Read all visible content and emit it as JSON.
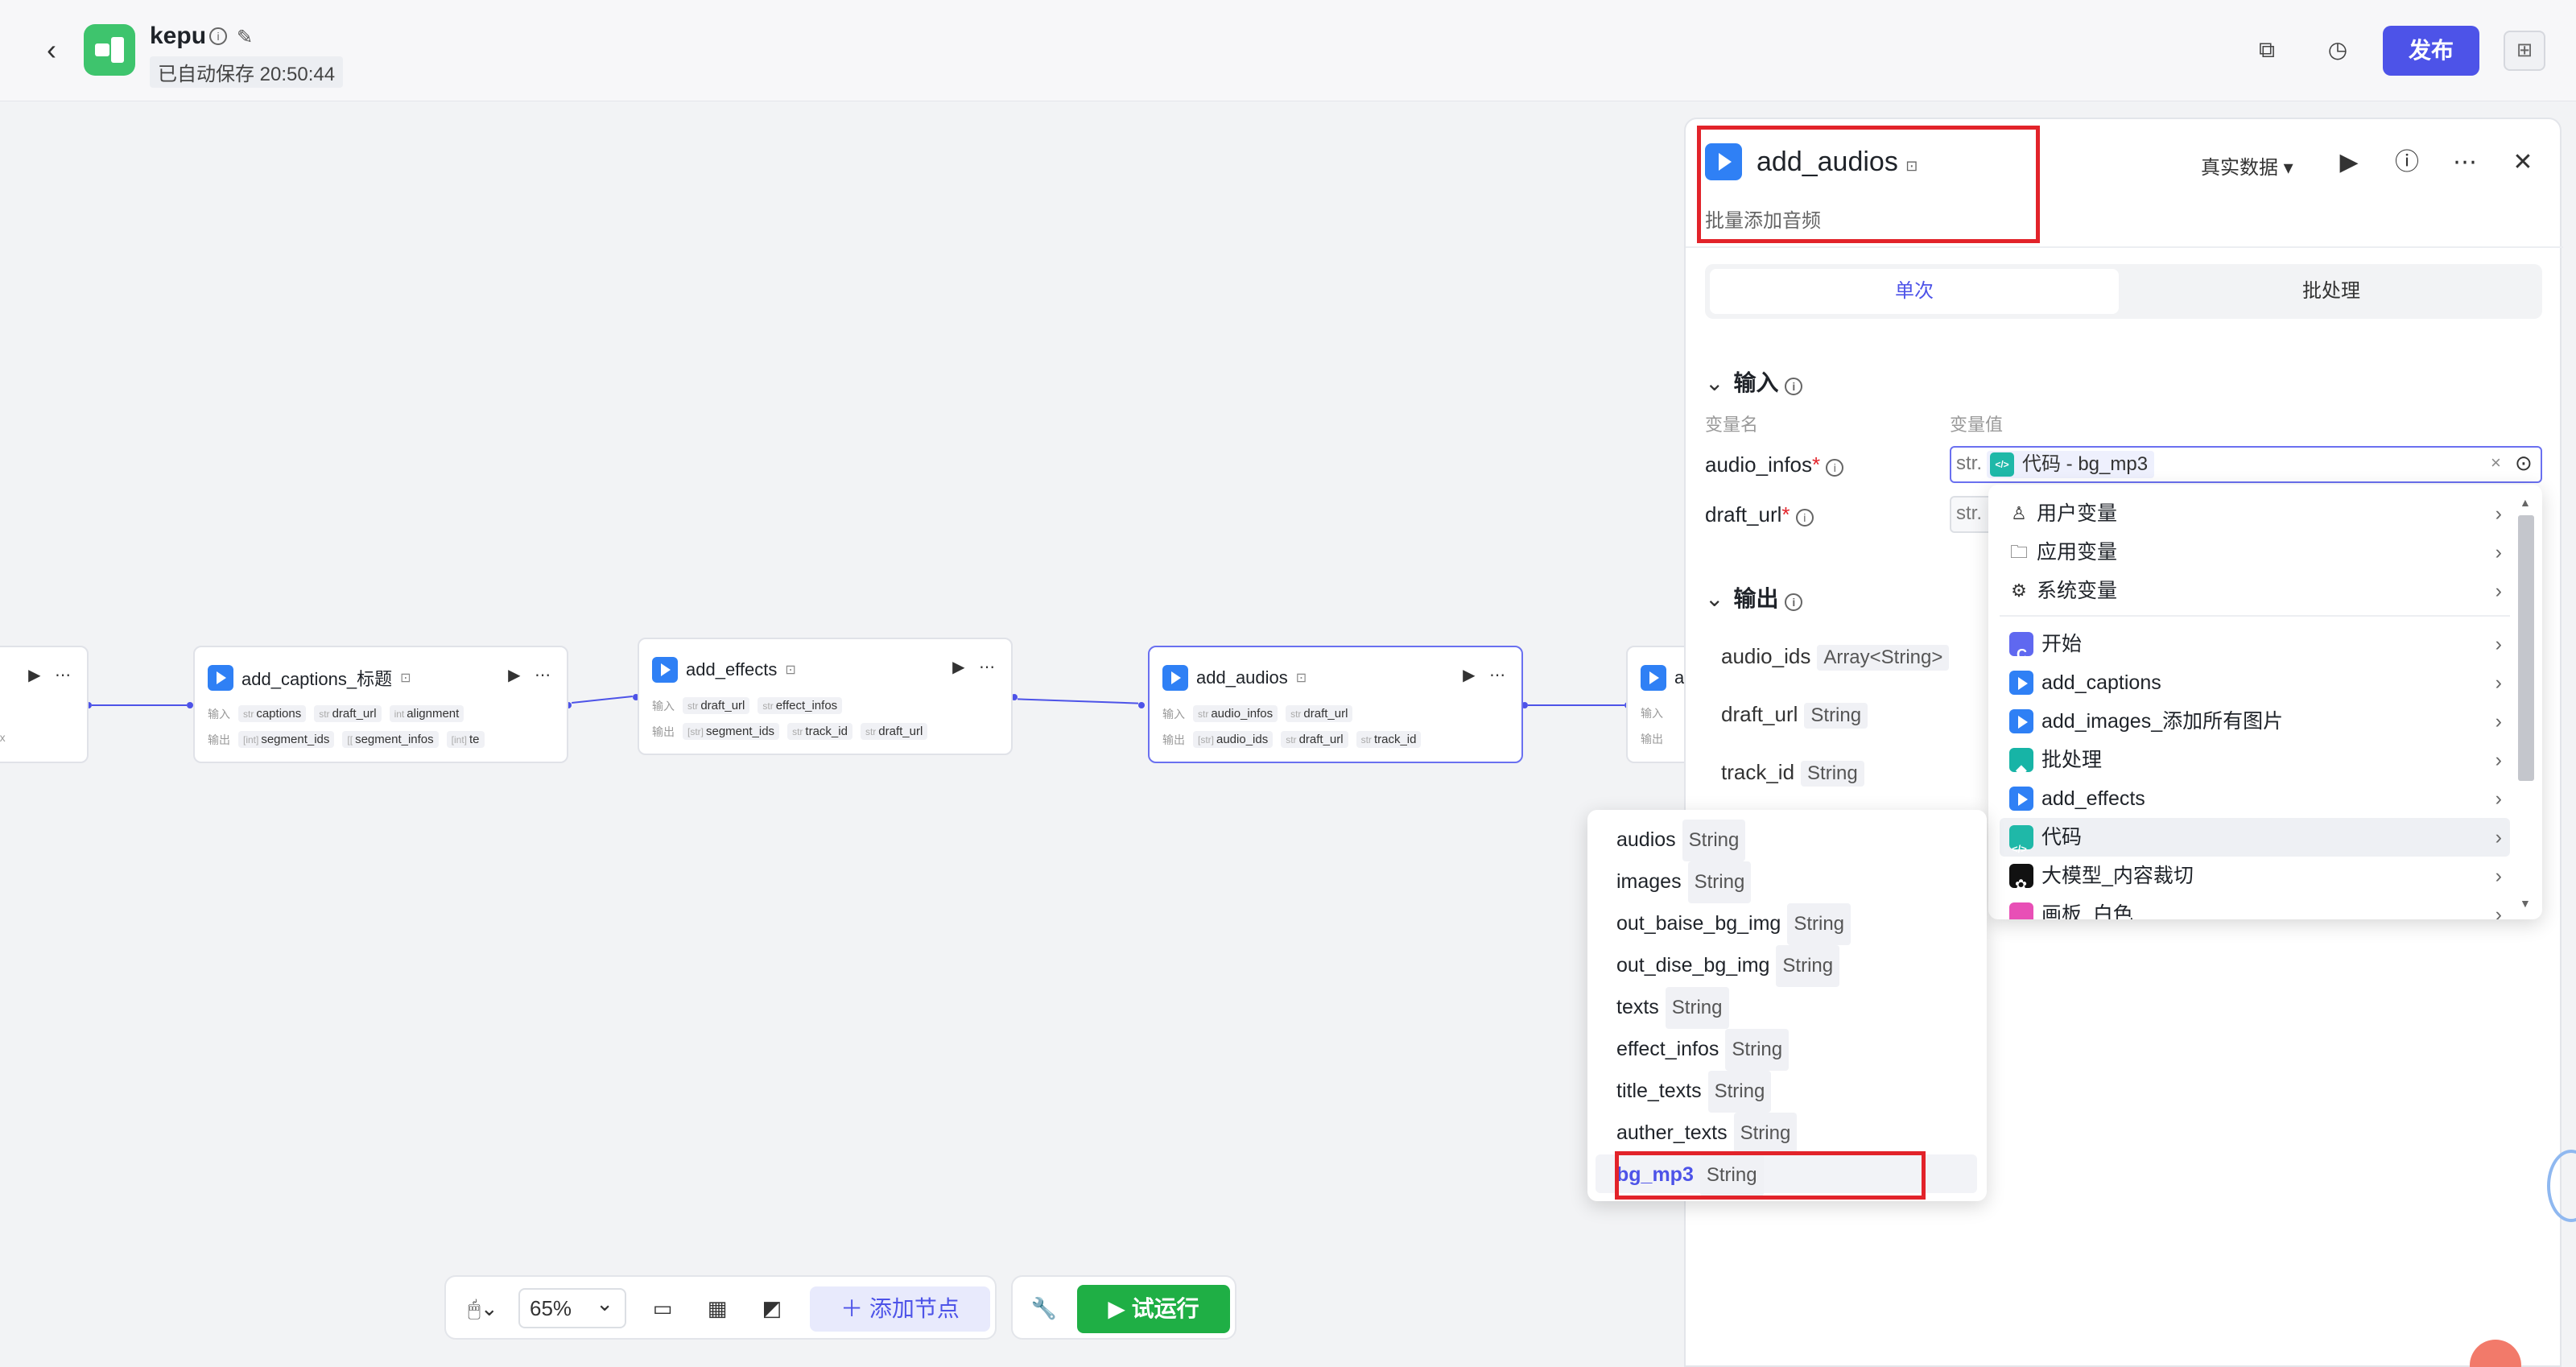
{
  "header": {
    "app_name": "kepu",
    "autosave": "已自动保存 20:50:44",
    "publish_label": "发布"
  },
  "nodes": [
    {
      "id": "left-partial",
      "title": "",
      "in": [
        "nt"
      ],
      "out": [
        "tex"
      ]
    },
    {
      "id": "add_captions",
      "title": "add_captions_标题",
      "in_label": "输入",
      "out_label": "输出",
      "in": [
        {
          "t": "str",
          "n": "captions"
        },
        {
          "t": "str",
          "n": "draft_url"
        },
        {
          "t": "int",
          "n": "alignment"
        }
      ],
      "out": [
        {
          "t": "[int]",
          "n": "segment_ids"
        },
        {
          "t": "[[",
          "n": "segment_infos"
        },
        {
          "t": "[int]",
          "n": "te"
        }
      ]
    },
    {
      "id": "add_effects",
      "title": "add_effects",
      "in_label": "输入",
      "out_label": "输出",
      "in": [
        {
          "t": "str",
          "n": "draft_url"
        },
        {
          "t": "str",
          "n": "effect_infos"
        }
      ],
      "out": [
        {
          "t": "[str]",
          "n": "segment_ids"
        },
        {
          "t": "str",
          "n": "track_id"
        },
        {
          "t": "str",
          "n": "draft_url"
        }
      ]
    },
    {
      "id": "add_audios",
      "title": "add_audios",
      "in_label": "输入",
      "out_label": "输出",
      "in": [
        {
          "t": "str",
          "n": "audio_infos"
        },
        {
          "t": "str",
          "n": "draft_url"
        }
      ],
      "out": [
        {
          "t": "[str]",
          "n": "audio_ids"
        },
        {
          "t": "str",
          "n": "draft_url"
        },
        {
          "t": "str",
          "n": "track_id"
        }
      ]
    },
    {
      "id": "right-partial",
      "title": "a",
      "in_label": "输入",
      "out_label": "输出"
    }
  ],
  "toolbar": {
    "zoom": "65%",
    "add_node": "添加节点",
    "test_run": "试运行"
  },
  "panel": {
    "title": "add_audios",
    "subtitle": "批量添加音频",
    "mode": "真实数据",
    "tabs": [
      "单次",
      "批处理"
    ],
    "input_section": "输入",
    "col_name": "变量名",
    "col_value": "变量值",
    "inputs": [
      {
        "name": "audio_infos",
        "prefix": "str.",
        "value": "代码 - bg_mp3"
      },
      {
        "name": "draft_url",
        "prefix": "str.",
        "value": ""
      }
    ],
    "output_section": "输出",
    "outputs": [
      {
        "name": "audio_ids",
        "type": "Array<String>"
      },
      {
        "name": "draft_url",
        "type": "String"
      },
      {
        "name": "track_id",
        "type": "String"
      }
    ]
  },
  "dropdown": {
    "groups": [
      {
        "label": "用户变量",
        "icon": "user-icon"
      },
      {
        "label": "应用变量",
        "icon": "folder-icon"
      },
      {
        "label": "系统变量",
        "icon": "gear-icon"
      }
    ],
    "nodes": [
      {
        "label": "开始",
        "icon": "start"
      },
      {
        "label": "add_captions",
        "icon": "plugin"
      },
      {
        "label": "add_images_添加所有图片",
        "icon": "plugin"
      },
      {
        "label": "批处理",
        "icon": "batch"
      },
      {
        "label": "add_effects",
        "icon": "plugin"
      },
      {
        "label": "代码",
        "icon": "code"
      },
      {
        "label": "大模型_内容裁切",
        "icon": "ai"
      },
      {
        "label": "画板_白色",
        "icon": "draw"
      }
    ]
  },
  "sub_dropdown": {
    "items": [
      {
        "name": "audios",
        "type": "String"
      },
      {
        "name": "images",
        "type": "String"
      },
      {
        "name": "out_baise_bg_img",
        "type": "String"
      },
      {
        "name": "out_dise_bg_img",
        "type": "String"
      },
      {
        "name": "texts",
        "type": "String"
      },
      {
        "name": "effect_infos",
        "type": "String"
      },
      {
        "name": "title_texts",
        "type": "String"
      },
      {
        "name": "auther_texts",
        "type": "String"
      },
      {
        "name": "bg_mp3",
        "type": "String"
      }
    ]
  },
  "colors": {
    "accent": "#4d53e8",
    "run": "#1faf45",
    "highlight": "#e2232a"
  }
}
